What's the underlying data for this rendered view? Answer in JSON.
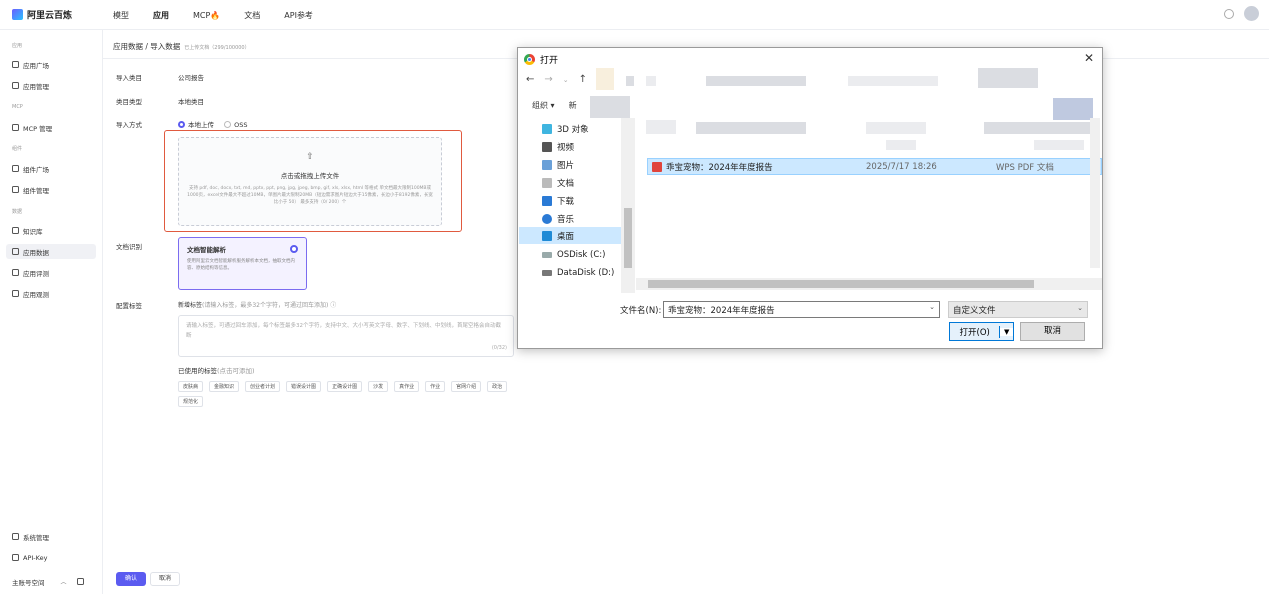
{
  "topbar": {
    "logo_text": "阿里云百炼",
    "nav": [
      "模型",
      "应用",
      "MCP🔥",
      "文档",
      "API参考"
    ]
  },
  "sidebar": {
    "groups": [
      "应用",
      "MCP",
      "组件",
      "数据"
    ],
    "items": [
      "应用广场",
      "应用管理",
      "MCP 管理",
      "组件广场",
      "组件管理",
      "知识库",
      "应用数据",
      "应用评测",
      "应用观测"
    ],
    "bottom": [
      "系统管理",
      "API-Key",
      "主账号空间"
    ]
  },
  "page": {
    "breadcrumb": "应用数据 / 导入数据",
    "breadcrumb_sub": "已上传文档（299/100000）",
    "fields": {
      "import_category_label": "导入类目",
      "import_category_value": "公司报告",
      "category_type_label": "类目类型",
      "category_type_value": "本地类目",
      "import_method_label": "导入方式",
      "method_local": "本地上传",
      "method_oss": "OSS"
    },
    "upload": {
      "title": "点击或拖拽上传文件",
      "desc": "支持 pdf, doc, docx, txt, md, pptx, ppt, png, jpg, jpeg, bmp, gif, xls, xlsx, html 等格式 单文档最大限制100MB或1000页，excel文件最大不超过10MB，单图片最大限制20MB（短边需求图片短边大于15像素，长边小于8192像素，长宽比小于 50） 最多支持（0/ 200）个"
    },
    "doc_recognition_label": "文档识别",
    "parse_card": {
      "title": "文档智能解析",
      "desc": "使用阿里云文档智能解析服务解析本文档，抽取文档内容、原始结构等信息。"
    },
    "config_tag_label": "配置标签",
    "tag_hint": "新增标签",
    "tag_hint_gray": "(请输入标签，最多32个字符，可通过回车添加)",
    "tag_placeholder": "请输入标签，可通过回车添加，每个标签最多32个字符，支持中文、大小写英文字母、数字、下划线、中划线，首尾空格会自动截断",
    "tag_count": "(0/32)",
    "used_tags_label": "已使用的标签",
    "used_tags_hint": "(点击可添加)",
    "used_tags": [
      "皮肤病",
      "金融知识",
      "创业者计划",
      "错误设计图",
      "正确设计图",
      "沙发",
      "真作业",
      "作业",
      "官网介绍",
      "政治",
      "规范化"
    ],
    "confirm": "确认",
    "cancel": "取消"
  },
  "dialog": {
    "title": "打开",
    "toolbar_organize": "组织 ▾",
    "toolbar_new": "新",
    "tree": [
      "3D 对象",
      "视频",
      "图片",
      "文档",
      "下载",
      "音乐",
      "桌面",
      "OSDisk (C:)",
      "DataDisk (D:)"
    ],
    "file": {
      "name": "乖宝宠物：2024年年度报告",
      "date": "2025/7/17 18:26",
      "type": "WPS PDF 文档"
    },
    "filename_label": "文件名(N):",
    "filename_value": "乖宝宠物：2024年年度报告",
    "filetype": "自定义文件",
    "open_btn": "打开(O)",
    "cancel_btn": "取消"
  }
}
